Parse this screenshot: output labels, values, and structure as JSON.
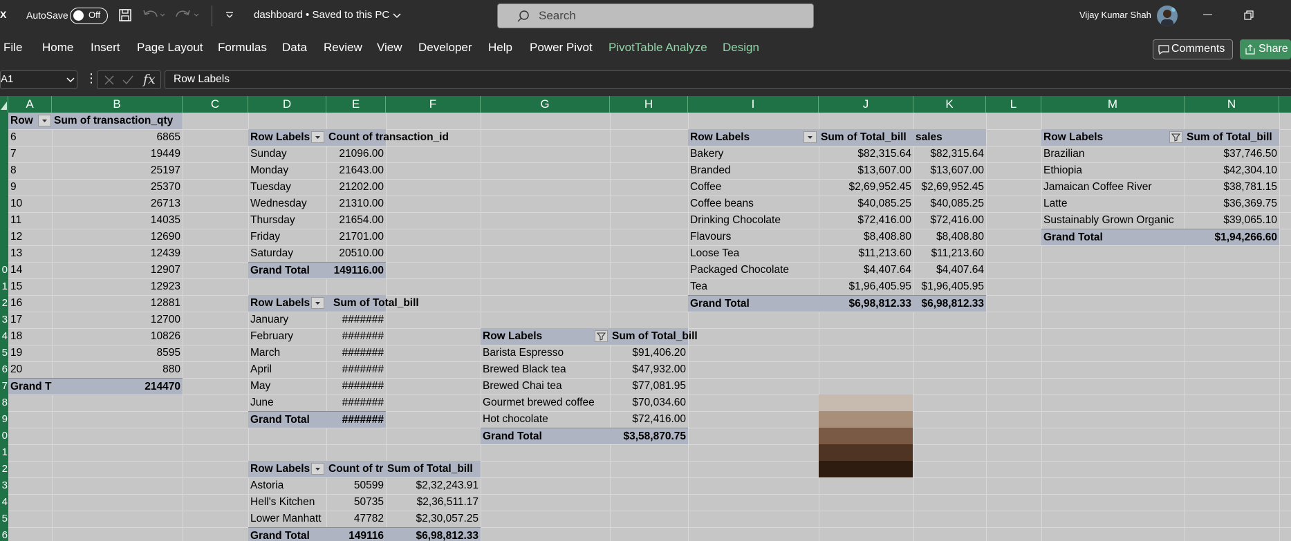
{
  "titlebar": {
    "app_icon": "X",
    "autosave_label": "AutoSave",
    "autosave_state": "Off",
    "doc_title": "dashboard • Saved to this PC",
    "search_placeholder": "Search",
    "user_name": "Vijay Kumar Shah"
  },
  "menu": {
    "items": [
      "File",
      "Home",
      "Insert",
      "Page Layout",
      "Formulas",
      "Data",
      "Review",
      "View",
      "Developer",
      "Help",
      "Power Pivot"
    ],
    "context_tabs": [
      "PivotTable Analyze",
      "Design"
    ],
    "comments_label": "Comments",
    "share_label": "Share"
  },
  "formula_bar": {
    "name_box": "A1",
    "content": "Row Labels"
  },
  "columns": [
    "A",
    "B",
    "C",
    "D",
    "E",
    "F",
    "G",
    "H",
    "I",
    "J",
    "K",
    "L",
    "M",
    "N"
  ],
  "row_numbers": [
    "",
    "",
    "",
    "",
    "",
    "",
    "",
    "",
    "",
    "0",
    "1",
    "2",
    "3",
    "4",
    "5",
    "6",
    "7",
    "8",
    "9",
    "0",
    "1",
    "2",
    "3",
    "4",
    "5",
    "6"
  ],
  "pivot_hour": {
    "header_a": "Row",
    "header_b": "Sum of transaction_qty",
    "rows": [
      [
        "6",
        "6865"
      ],
      [
        "7",
        "19449"
      ],
      [
        "8",
        "25197"
      ],
      [
        "9",
        "25370"
      ],
      [
        "10",
        "26713"
      ],
      [
        "11",
        "14035"
      ],
      [
        "12",
        "12690"
      ],
      [
        "13",
        "12439"
      ],
      [
        "14",
        "12907"
      ],
      [
        "15",
        "12923"
      ],
      [
        "16",
        "12881"
      ],
      [
        "17",
        "12700"
      ],
      [
        "18",
        "10826"
      ],
      [
        "19",
        "8595"
      ],
      [
        "20",
        "880"
      ]
    ],
    "total_label": "Grand T",
    "total_value": "214470"
  },
  "pivot_day": {
    "header_a": "Row Labels",
    "header_b": "Count of transaction_id",
    "rows": [
      [
        "Sunday",
        "21096.00"
      ],
      [
        "Monday",
        "21643.00"
      ],
      [
        "Tuesday",
        "21202.00"
      ],
      [
        "Wednesday",
        "21310.00"
      ],
      [
        "Thursday",
        "21654.00"
      ],
      [
        "Friday",
        "21701.00"
      ],
      [
        "Saturday",
        "20510.00"
      ]
    ],
    "total_label": "Grand Total",
    "total_value": "149116.00"
  },
  "pivot_month": {
    "header_a": "Row Labels",
    "header_b": "Sum of Total_bill",
    "rows": [
      [
        "January",
        "#######"
      ],
      [
        "February",
        "#######"
      ],
      [
        "March",
        "#######"
      ],
      [
        "April",
        "#######"
      ],
      [
        "May",
        "#######"
      ],
      [
        "June",
        "#######"
      ]
    ],
    "total_label": "Grand Total",
    "total_value": "#######"
  },
  "pivot_store": {
    "header_a": "Row Labels",
    "header_b": "Count of tr",
    "header_c": "Sum of Total_bill",
    "rows": [
      [
        "Astoria",
        "50599",
        "$2,32,243.91"
      ],
      [
        "Hell's Kitchen",
        "50735",
        "$2,36,511.17"
      ],
      [
        "Lower Manhatt",
        "47782",
        "$2,30,057.25"
      ]
    ],
    "total_label": "Grand Total",
    "total_count": "149116",
    "total_value": "$6,98,812.33"
  },
  "pivot_type": {
    "header_a": "Row Labels",
    "header_b": "Sum of Total_bill",
    "rows": [
      [
        "Barista Espresso",
        "$91,406.20"
      ],
      [
        "Brewed Black tea",
        "$47,932.00"
      ],
      [
        "Brewed Chai tea",
        "$77,081.95"
      ],
      [
        "Gourmet brewed coffee",
        "$70,034.60"
      ],
      [
        "Hot chocolate",
        "$72,416.00"
      ]
    ],
    "total_label": "Grand Total",
    "total_value": "$3,58,870.75"
  },
  "pivot_category": {
    "header_a": "Row Labels",
    "header_b": "Sum of Total_bill",
    "header_c": "sales",
    "rows": [
      [
        "Bakery",
        "$82,315.64",
        "$82,315.64"
      ],
      [
        "Branded",
        "$13,607.00",
        "$13,607.00"
      ],
      [
        "Coffee",
        "$2,69,952.45",
        "$2,69,952.45"
      ],
      [
        "Coffee beans",
        "$40,085.25",
        "$40,085.25"
      ],
      [
        "Drinking Chocolate",
        "$72,416.00",
        "$72,416.00"
      ],
      [
        "Flavours",
        "$8,408.80",
        "$8,408.80"
      ],
      [
        "Loose Tea",
        "$11,213.60",
        "$11,213.60"
      ],
      [
        "Packaged Chocolate",
        "$4,407.64",
        "$4,407.64"
      ],
      [
        "Tea",
        "$1,96,405.95",
        "$1,96,405.95"
      ]
    ],
    "total_label": "Grand Total",
    "total_b": "$6,98,812.33",
    "total_c": "$6,98,812.33"
  },
  "pivot_coffee": {
    "header_a": "Row Labels",
    "header_b": "Sum of Total_bill",
    "rows": [
      [
        "Brazilian",
        "$37,746.50"
      ],
      [
        "Ethiopia",
        "$42,304.10"
      ],
      [
        "Jamaican Coffee River",
        "$38,781.15"
      ],
      [
        "Latte",
        "$36,369.75"
      ],
      [
        "Sustainably Grown Organic",
        "$39,065.10"
      ]
    ],
    "total_label": "Grand Total",
    "total_value": "$1,94,266.60"
  },
  "swatches": [
    "#c7bbb0",
    "#a88f7a",
    "#7a5a45",
    "#4f3423",
    "#2e1c10"
  ]
}
